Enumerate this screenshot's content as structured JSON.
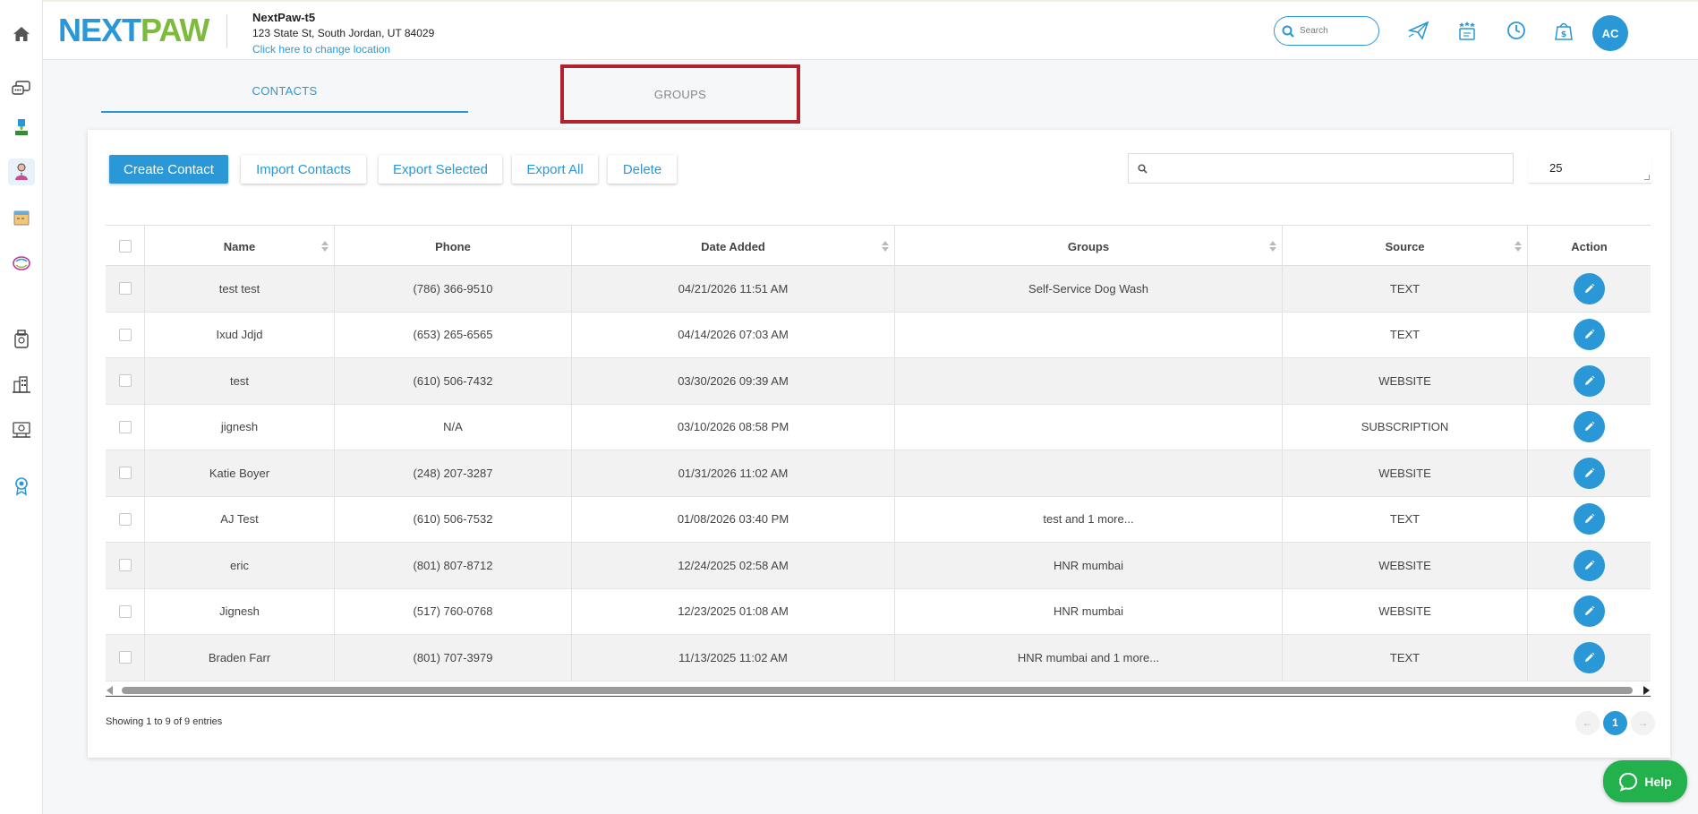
{
  "header": {
    "logo_part1": "NEXT",
    "logo_part2": "PAW",
    "location_name": "NextPaw-t5",
    "location_address": "123 State St, South Jordan, UT 84029",
    "change_location": "Click here to change location",
    "search_placeholder": "Search",
    "avatar_initials": "AC",
    "icons": [
      "send-icon",
      "ratings-icon",
      "clock-icon",
      "cash-icon"
    ]
  },
  "sidebar": {
    "icons": [
      "home-icon",
      "chat-icon",
      "paint-icon",
      "contacts-icon",
      "calendar-icon",
      "marketing-icon",
      "store-icon",
      "building-icon",
      "reports-icon",
      "award-icon"
    ]
  },
  "tabs": {
    "contacts": "CONTACTS",
    "groups": "GROUPS"
  },
  "toolbar": {
    "create": "Create Contact",
    "import": "Import Contacts",
    "export_selected": "Export Selected",
    "export_all": "Export All",
    "delete": "Delete",
    "page_size": "25"
  },
  "table": {
    "columns": [
      "Name",
      "Phone",
      "Date Added",
      "Groups",
      "Source",
      "Action"
    ],
    "rows": [
      {
        "name": "test test",
        "phone": "(786) 366-9510",
        "date": "04/21/2026 11:51 AM",
        "groups": "Self-Service Dog Wash",
        "source": "TEXT"
      },
      {
        "name": "Ixud Jdjd",
        "phone": "(653) 265-6565",
        "date": "04/14/2026 07:03 AM",
        "groups": "",
        "source": "TEXT"
      },
      {
        "name": "test",
        "phone": "(610) 506-7432",
        "date": "03/30/2026 09:39 AM",
        "groups": "",
        "source": "WEBSITE"
      },
      {
        "name": "jignesh",
        "phone": "N/A",
        "date": "03/10/2026 08:58 PM",
        "groups": "",
        "source": "SUBSCRIPTION"
      },
      {
        "name": "Katie Boyer",
        "phone": "(248) 207-3287",
        "date": "01/31/2026 11:02 AM",
        "groups": "",
        "source": "WEBSITE"
      },
      {
        "name": "AJ Test",
        "phone": "(610) 506-7532",
        "date": "01/08/2026 03:40 PM",
        "groups": "test and 1 more...",
        "source": "TEXT"
      },
      {
        "name": "eric",
        "phone": "(801) 807-8712",
        "date": "12/24/2025 02:58 AM",
        "groups": "HNR mumbai",
        "source": "WEBSITE"
      },
      {
        "name": "Jignesh",
        "phone": "(517) 760-0768",
        "date": "12/23/2025 01:08 AM",
        "groups": "HNR mumbai",
        "source": "WEBSITE"
      },
      {
        "name": "Braden Farr",
        "phone": "(801) 707-3979",
        "date": "11/13/2025 11:02 AM",
        "groups": "HNR mumbai and 1 more...",
        "source": "TEXT"
      }
    ]
  },
  "footer": {
    "info": "Showing 1 to 9 of 9 entries",
    "prev": "←",
    "current_page": "1",
    "next": "→"
  },
  "help": {
    "label": "Help"
  },
  "colors": {
    "primary": "#2a97d6",
    "logo_green": "#7dbb3c",
    "highlight": "#b3212c",
    "help": "#22b14c"
  }
}
